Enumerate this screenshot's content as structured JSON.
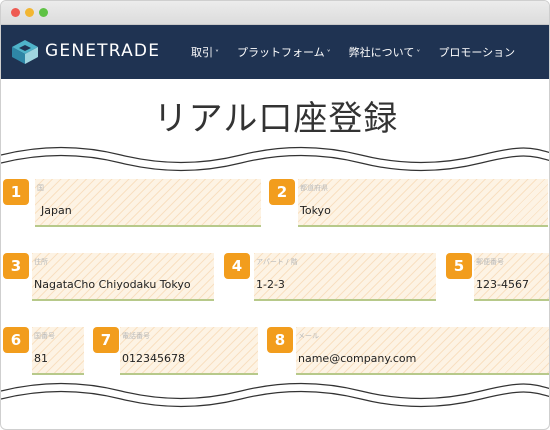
{
  "nav": {
    "brand": "GENETRADE",
    "items": [
      {
        "label": "取引",
        "has_dropdown": true
      },
      {
        "label": "プラットフォーム",
        "has_dropdown": true
      },
      {
        "label": "弊社について",
        "has_dropdown": true
      },
      {
        "label": "プロモーション",
        "has_dropdown": false
      }
    ],
    "chevron": "˅"
  },
  "page": {
    "title": "リアル口座登録"
  },
  "form": {
    "fields": [
      {
        "number": "1",
        "label": "国",
        "value": "Japan"
      },
      {
        "number": "2",
        "label": "都道府県",
        "value": "Tokyo"
      },
      {
        "number": "3",
        "label": "住所",
        "value": "NagataCho Chiyodaku Tokyo"
      },
      {
        "number": "4",
        "label": "アパート / 階",
        "value": "1-2-3"
      },
      {
        "number": "5",
        "label": "郵便番号",
        "value": "123-4567"
      },
      {
        "number": "6",
        "label": "国番号",
        "value": "81"
      },
      {
        "number": "7",
        "label": "電話番号",
        "value": "012345678"
      },
      {
        "number": "8",
        "label": "メール",
        "value": "name@company.com"
      }
    ]
  },
  "colors": {
    "navbar": "#1f3352",
    "badge": "#f29d1d",
    "field_fill": "#fdf3e4",
    "field_underline": "#b7c98a"
  }
}
